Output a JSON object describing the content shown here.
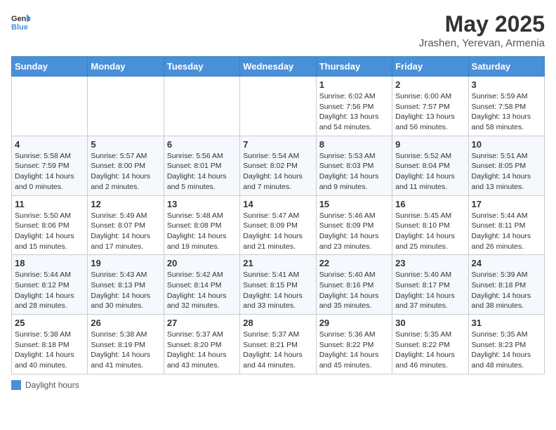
{
  "header": {
    "logo_general": "General",
    "logo_blue": "Blue",
    "title": "May 2025",
    "subtitle": "Jrashen, Yerevan, Armenia"
  },
  "days_of_week": [
    "Sunday",
    "Monday",
    "Tuesday",
    "Wednesday",
    "Thursday",
    "Friday",
    "Saturday"
  ],
  "weeks": [
    [
      {
        "day": "",
        "info": ""
      },
      {
        "day": "",
        "info": ""
      },
      {
        "day": "",
        "info": ""
      },
      {
        "day": "",
        "info": ""
      },
      {
        "day": "1",
        "info": "Sunrise: 6:02 AM\nSunset: 7:56 PM\nDaylight: 13 hours and 54 minutes."
      },
      {
        "day": "2",
        "info": "Sunrise: 6:00 AM\nSunset: 7:57 PM\nDaylight: 13 hours and 56 minutes."
      },
      {
        "day": "3",
        "info": "Sunrise: 5:59 AM\nSunset: 7:58 PM\nDaylight: 13 hours and 58 minutes."
      }
    ],
    [
      {
        "day": "4",
        "info": "Sunrise: 5:58 AM\nSunset: 7:59 PM\nDaylight: 14 hours and 0 minutes."
      },
      {
        "day": "5",
        "info": "Sunrise: 5:57 AM\nSunset: 8:00 PM\nDaylight: 14 hours and 2 minutes."
      },
      {
        "day": "6",
        "info": "Sunrise: 5:56 AM\nSunset: 8:01 PM\nDaylight: 14 hours and 5 minutes."
      },
      {
        "day": "7",
        "info": "Sunrise: 5:54 AM\nSunset: 8:02 PM\nDaylight: 14 hours and 7 minutes."
      },
      {
        "day": "8",
        "info": "Sunrise: 5:53 AM\nSunset: 8:03 PM\nDaylight: 14 hours and 9 minutes."
      },
      {
        "day": "9",
        "info": "Sunrise: 5:52 AM\nSunset: 8:04 PM\nDaylight: 14 hours and 11 minutes."
      },
      {
        "day": "10",
        "info": "Sunrise: 5:51 AM\nSunset: 8:05 PM\nDaylight: 14 hours and 13 minutes."
      }
    ],
    [
      {
        "day": "11",
        "info": "Sunrise: 5:50 AM\nSunset: 8:06 PM\nDaylight: 14 hours and 15 minutes."
      },
      {
        "day": "12",
        "info": "Sunrise: 5:49 AM\nSunset: 8:07 PM\nDaylight: 14 hours and 17 minutes."
      },
      {
        "day": "13",
        "info": "Sunrise: 5:48 AM\nSunset: 8:08 PM\nDaylight: 14 hours and 19 minutes."
      },
      {
        "day": "14",
        "info": "Sunrise: 5:47 AM\nSunset: 8:09 PM\nDaylight: 14 hours and 21 minutes."
      },
      {
        "day": "15",
        "info": "Sunrise: 5:46 AM\nSunset: 8:09 PM\nDaylight: 14 hours and 23 minutes."
      },
      {
        "day": "16",
        "info": "Sunrise: 5:45 AM\nSunset: 8:10 PM\nDaylight: 14 hours and 25 minutes."
      },
      {
        "day": "17",
        "info": "Sunrise: 5:44 AM\nSunset: 8:11 PM\nDaylight: 14 hours and 26 minutes."
      }
    ],
    [
      {
        "day": "18",
        "info": "Sunrise: 5:44 AM\nSunset: 8:12 PM\nDaylight: 14 hours and 28 minutes."
      },
      {
        "day": "19",
        "info": "Sunrise: 5:43 AM\nSunset: 8:13 PM\nDaylight: 14 hours and 30 minutes."
      },
      {
        "day": "20",
        "info": "Sunrise: 5:42 AM\nSunset: 8:14 PM\nDaylight: 14 hours and 32 minutes."
      },
      {
        "day": "21",
        "info": "Sunrise: 5:41 AM\nSunset: 8:15 PM\nDaylight: 14 hours and 33 minutes."
      },
      {
        "day": "22",
        "info": "Sunrise: 5:40 AM\nSunset: 8:16 PM\nDaylight: 14 hours and 35 minutes."
      },
      {
        "day": "23",
        "info": "Sunrise: 5:40 AM\nSunset: 8:17 PM\nDaylight: 14 hours and 37 minutes."
      },
      {
        "day": "24",
        "info": "Sunrise: 5:39 AM\nSunset: 8:18 PM\nDaylight: 14 hours and 38 minutes."
      }
    ],
    [
      {
        "day": "25",
        "info": "Sunrise: 5:38 AM\nSunset: 8:18 PM\nDaylight: 14 hours and 40 minutes."
      },
      {
        "day": "26",
        "info": "Sunrise: 5:38 AM\nSunset: 8:19 PM\nDaylight: 14 hours and 41 minutes."
      },
      {
        "day": "27",
        "info": "Sunrise: 5:37 AM\nSunset: 8:20 PM\nDaylight: 14 hours and 43 minutes."
      },
      {
        "day": "28",
        "info": "Sunrise: 5:37 AM\nSunset: 8:21 PM\nDaylight: 14 hours and 44 minutes."
      },
      {
        "day": "29",
        "info": "Sunrise: 5:36 AM\nSunset: 8:22 PM\nDaylight: 14 hours and 45 minutes."
      },
      {
        "day": "30",
        "info": "Sunrise: 5:35 AM\nSunset: 8:22 PM\nDaylight: 14 hours and 46 minutes."
      },
      {
        "day": "31",
        "info": "Sunrise: 5:35 AM\nSunset: 8:23 PM\nDaylight: 14 hours and 48 minutes."
      }
    ]
  ],
  "footer": {
    "daylight_label": "Daylight hours"
  }
}
